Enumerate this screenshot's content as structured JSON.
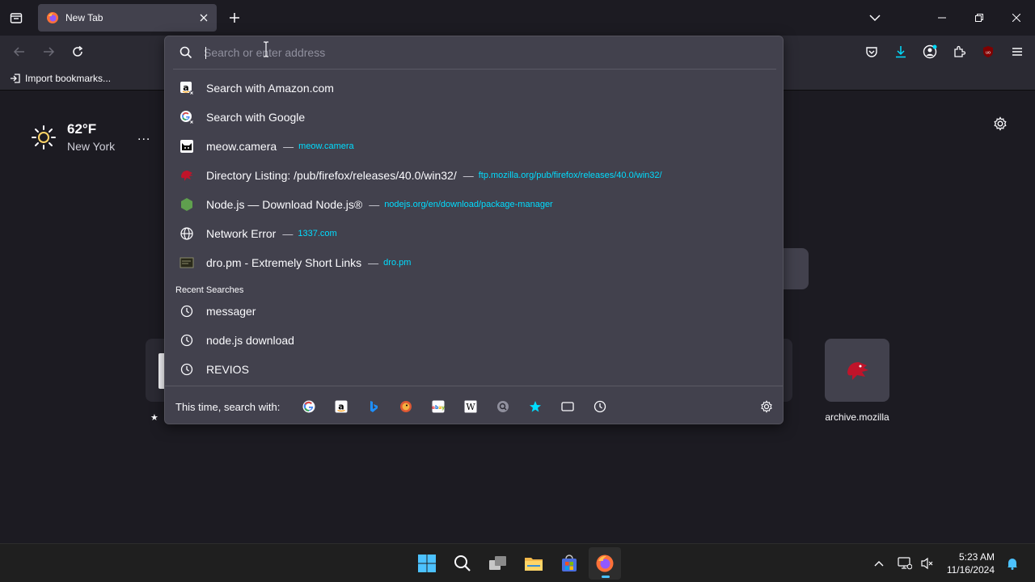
{
  "tabs": [
    {
      "title": "New Tab",
      "active": true
    }
  ],
  "urlbar": {
    "placeholder": "Search or enter address"
  },
  "bookmarks": {
    "import_label": "Import bookmarks..."
  },
  "weather": {
    "temp": "62°F",
    "city": "New York",
    "more": "..."
  },
  "suggestions": [
    {
      "icon": "amazon-icon",
      "title": "Search with Amazon.com",
      "url": ""
    },
    {
      "icon": "google-icon",
      "title": "Search with Google",
      "url": ""
    },
    {
      "icon": "meow-camera-icon",
      "title": "meow.camera",
      "sep": "—",
      "url": "meow.camera"
    },
    {
      "icon": "mozilla-dino-icon",
      "title": "Directory Listing: /pub/firefox/releases/40.0/win32/",
      "sep": "—",
      "url": "ftp.mozilla.org/pub/firefox/releases/40.0/win32/"
    },
    {
      "icon": "nodejs-icon",
      "title": "Node.js — Download Node.js®",
      "sep": "—",
      "url": "nodejs.org/en/download/package-manager"
    },
    {
      "icon": "globe-icon",
      "title": "Network Error",
      "sep": "—",
      "url": "1337.com"
    },
    {
      "icon": "dro-pm-icon",
      "title": "dro.pm - Extremely Short Links",
      "sep": "—",
      "url": "dro.pm"
    }
  ],
  "recent_searches": {
    "label": "Recent Searches",
    "items": [
      "messager",
      "node.js download",
      "REVIOS"
    ]
  },
  "oneoff": {
    "label": "This time, search with:",
    "engines": [
      "google-icon",
      "amazon-icon",
      "bing-icon",
      "duckduckgo-icon",
      "ebay-icon",
      "wikipedia-icon",
      "search-engine-icon",
      "bookmarks-icon",
      "tabs-icon",
      "history-icon"
    ]
  },
  "top_sites": [
    {
      "label": "archive.mozilla"
    }
  ],
  "taskbar": {
    "time": "5:23 AM",
    "date": "11/16/2024"
  },
  "colors": {
    "accent": "#00ddff",
    "popup_bg": "#42414d",
    "toolbar_bg": "#2b2a33",
    "page_bg": "#1c1b22"
  }
}
